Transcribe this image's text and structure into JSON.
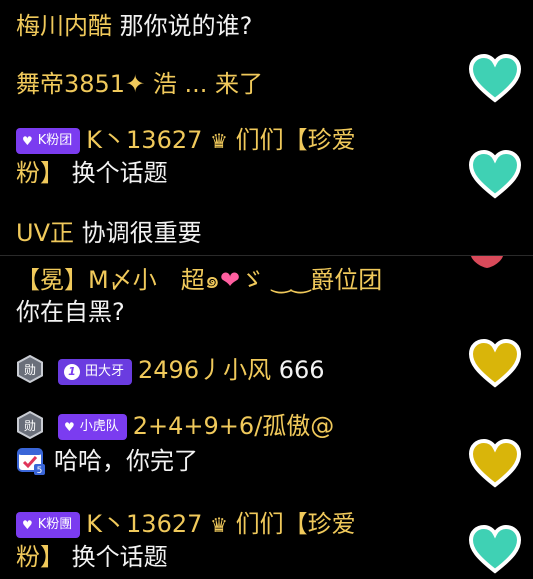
{
  "messages": [
    {
      "user": "梅川内酷",
      "text": "那你说的谁?"
    },
    {
      "user": "舞帝3851",
      "text": "浩 ... 来了"
    },
    {
      "badge": "K粉团",
      "user": "K丶13627",
      "user_suffix": "们们【珍爱",
      "text_line2_prefix": "粉】",
      "text": "换个话题"
    },
    {
      "user": "UV正",
      "text": "协调很重要"
    },
    {
      "user": "【冕】M〆小　超๑",
      "user_tail": "ゞ ‿‿爵位团",
      "text": "你在自黑?"
    },
    {
      "level": "勋",
      "badge": "田大牙",
      "user": "2496丿小风",
      "text": "666"
    },
    {
      "level": "勋",
      "badge": "小虎队",
      "user": "2+4+9+6/孤傲@",
      "text": "哈哈，你完了"
    },
    {
      "badge": "K粉團",
      "user": "K丶13627",
      "user_suffix": "们们【珍爱",
      "text_line2_prefix": "粉】",
      "text": "换个话题"
    }
  ],
  "colors": {
    "name": "#f0c95b",
    "teal_heart": "#3fd1b4",
    "yellow_heart": "#d9b50a",
    "badge": "#7b3cf0"
  }
}
